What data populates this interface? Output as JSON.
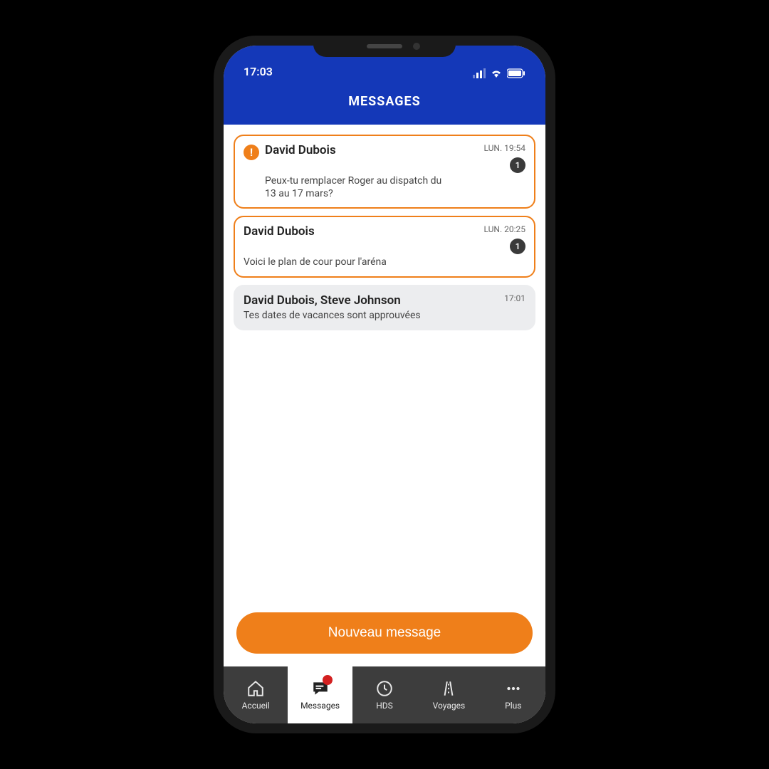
{
  "status": {
    "time": "17:03"
  },
  "header": {
    "title": "MESSAGES"
  },
  "messages": [
    {
      "sender": "David Dubois",
      "preview": "Peux-tu remplacer Roger au dispatch du 13 au 17 mars?",
      "time": "LUN. 19:54",
      "badge": "1",
      "alert": "!"
    },
    {
      "sender": "David Dubois",
      "preview": "Voici le plan de cour pour l'aréna",
      "time": "LUN. 20:25",
      "badge": "1"
    },
    {
      "sender": "David Dubois, Steve Johnson",
      "preview": "Tes dates de vacances sont approuvées",
      "time": "17:01"
    }
  ],
  "actions": {
    "new_message": "Nouveau message"
  },
  "tabs": {
    "home": "Accueil",
    "messages": "Messages",
    "hds": "HDS",
    "voyages": "Voyages",
    "plus": "Plus"
  }
}
